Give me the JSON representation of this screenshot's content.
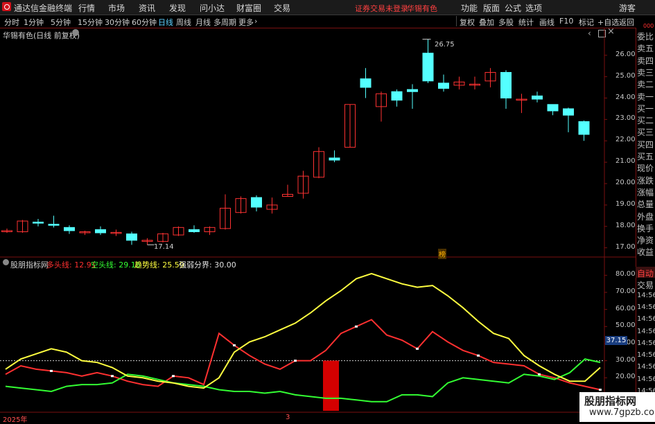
{
  "menu": {
    "app_title": "通达信金融终端",
    "items": [
      "行情",
      "市场",
      "资讯",
      "发现",
      "问小达",
      "财富圈",
      "交易"
    ],
    "login_status": "证券交易未登录",
    "stock_name": "华锡有色",
    "right_items": [
      "功能",
      "版面",
      "公式",
      "选项"
    ],
    "guest": "游客"
  },
  "periods": {
    "items": [
      "分时",
      "1分钟",
      "5分钟",
      "15分钟",
      "30分钟",
      "60分钟",
      "日线",
      "周线",
      "月线",
      "多周期",
      "更多"
    ],
    "active": "日线",
    "right_items": [
      "复权",
      "叠加",
      "多股",
      "统计",
      "画线",
      "F10",
      "标记",
      "+自选",
      "返回"
    ]
  },
  "main_chart": {
    "title": "华锡有色(日线 前复权)",
    "high_label": "26.75",
    "low_label": "17.14",
    "marker_label": "榜",
    "corner_label": "000"
  },
  "indicator": {
    "name": "股朋指标网",
    "lines": [
      {
        "label": "多头线:",
        "value": "12.91",
        "color": "#ff3030"
      },
      {
        "label": "空头线:",
        "value": "29.16",
        "color": "#33ff33"
      },
      {
        "label": "趋势线:",
        "value": "25.59",
        "color": "#ffff40"
      },
      {
        "label": "强弱分界:",
        "value": "30.00",
        "color": "#e0e0e0"
      }
    ],
    "current_value": "37.15"
  },
  "sidebar": {
    "main_items": [
      "委比",
      "卖五",
      "卖四",
      "卖三",
      "卖二",
      "卖一",
      "买一",
      "买二",
      "买三",
      "买四",
      "买五",
      "现价",
      "涨跌",
      "涨幅",
      "总量",
      "外盘",
      "换手",
      "净资",
      "收益"
    ],
    "sub_items": [
      "自动",
      "交易",
      "14:56",
      "14:56",
      "14:56",
      "14:56",
      "14:56",
      "14:56",
      "14:56",
      "14:56",
      "14:56"
    ]
  },
  "date_axis": {
    "labels": [
      "2025年",
      "3"
    ]
  },
  "watermark": {
    "line1": "股朋指标网",
    "line2": "www.7gpzb.com"
  },
  "chart_data": [
    {
      "type": "candlestick",
      "title": "华锡有色(日线 前复权)",
      "y_ticks": [
        17.0,
        18.0,
        19.0,
        20.0,
        21.0,
        22.0,
        23.0,
        24.0,
        25.0,
        26.0
      ],
      "ylim": [
        16.6,
        26.9
      ],
      "candles": [
        {
          "o": 17.78,
          "c": 17.8,
          "h": 17.9,
          "l": 17.7
        },
        {
          "o": 17.75,
          "c": 18.25,
          "h": 18.3,
          "l": 17.7
        },
        {
          "o": 18.2,
          "c": 18.15,
          "h": 18.35,
          "l": 18.0
        },
        {
          "o": 18.1,
          "c": 18.05,
          "h": 18.5,
          "l": 17.95
        },
        {
          "o": 17.95,
          "c": 17.8,
          "h": 18.05,
          "l": 17.65
        },
        {
          "o": 17.7,
          "c": 17.75,
          "h": 17.8,
          "l": 17.6
        },
        {
          "o": 17.85,
          "c": 17.7,
          "h": 18.0,
          "l": 17.6
        },
        {
          "o": 17.7,
          "c": 17.72,
          "h": 17.85,
          "l": 17.55
        },
        {
          "o": 17.65,
          "c": 17.35,
          "h": 17.75,
          "l": 17.14
        },
        {
          "o": 17.3,
          "c": 17.35,
          "h": 17.45,
          "l": 17.14
        },
        {
          "o": 17.3,
          "c": 17.65,
          "h": 17.7,
          "l": 17.25
        },
        {
          "o": 17.6,
          "c": 17.95,
          "h": 18.0,
          "l": 17.55
        },
        {
          "o": 17.85,
          "c": 17.75,
          "h": 18.05,
          "l": 17.7
        },
        {
          "o": 17.75,
          "c": 17.95,
          "h": 18.0,
          "l": 17.6
        },
        {
          "o": 17.9,
          "c": 18.85,
          "h": 19.5,
          "l": 17.85
        },
        {
          "o": 18.65,
          "c": 19.3,
          "h": 19.4,
          "l": 18.6
        },
        {
          "o": 19.35,
          "c": 18.9,
          "h": 19.45,
          "l": 18.7
        },
        {
          "o": 18.8,
          "c": 19.0,
          "h": 19.35,
          "l": 18.6
        },
        {
          "o": 19.4,
          "c": 19.5,
          "h": 19.95,
          "l": 19.4
        },
        {
          "o": 19.55,
          "c": 20.35,
          "h": 20.6,
          "l": 19.3
        },
        {
          "o": 20.3,
          "c": 21.5,
          "h": 21.7,
          "l": 20.25
        },
        {
          "o": 21.2,
          "c": 21.1,
          "h": 21.55,
          "l": 21.0
        },
        {
          "o": 21.7,
          "c": 23.7,
          "h": 23.7,
          "l": 21.7
        },
        {
          "o": 24.9,
          "c": 24.5,
          "h": 25.4,
          "l": 24.0
        },
        {
          "o": 23.6,
          "c": 24.2,
          "h": 24.3,
          "l": 22.9
        },
        {
          "o": 24.3,
          "c": 23.9,
          "h": 24.4,
          "l": 23.6
        },
        {
          "o": 24.4,
          "c": 24.3,
          "h": 24.65,
          "l": 23.5
        },
        {
          "o": 26.1,
          "c": 24.8,
          "h": 26.75,
          "l": 24.7
        },
        {
          "o": 24.7,
          "c": 24.45,
          "h": 25.1,
          "l": 24.3
        },
        {
          "o": 24.6,
          "c": 24.75,
          "h": 25.0,
          "l": 24.4
        },
        {
          "o": 24.6,
          "c": 24.65,
          "h": 25.0,
          "l": 24.4
        },
        {
          "o": 24.8,
          "c": 25.2,
          "h": 25.4,
          "l": 24.5
        },
        {
          "o": 25.2,
          "c": 24.0,
          "h": 25.3,
          "l": 23.5
        },
        {
          "o": 23.95,
          "c": 23.95,
          "h": 24.2,
          "l": 23.3
        },
        {
          "o": 24.1,
          "c": 23.95,
          "h": 24.3,
          "l": 23.8
        },
        {
          "o": 23.7,
          "c": 23.4,
          "h": 23.7,
          "l": 23.2
        },
        {
          "o": 23.5,
          "c": 23.2,
          "h": 23.55,
          "l": 22.4
        },
        {
          "o": 22.9,
          "c": 22.3,
          "h": 22.95,
          "l": 22.0
        }
      ]
    },
    {
      "type": "line",
      "title": "股朋指标网",
      "y_ticks": [
        20,
        30,
        40,
        50,
        60,
        70,
        80
      ],
      "ylim": [
        12,
        85
      ],
      "threshold": 30,
      "series": [
        {
          "name": "多头线",
          "color": "#ff3030",
          "values": [
            22,
            27,
            25,
            24,
            23,
            21,
            23,
            21,
            18,
            16,
            15,
            21,
            20,
            16,
            46,
            39,
            33,
            28,
            25,
            30,
            30,
            36,
            46,
            50,
            54,
            45,
            42,
            37,
            47,
            41,
            36,
            33,
            29,
            28,
            27,
            22,
            20,
            17,
            15,
            13
          ]
        },
        {
          "name": "空头线",
          "color": "#33ff33",
          "values": [
            15,
            14,
            13,
            12,
            15,
            16,
            16,
            17,
            22,
            21,
            19,
            17,
            16,
            15,
            13,
            12,
            12,
            11,
            12,
            10,
            9,
            8,
            8,
            7,
            6,
            6,
            10,
            10,
            9,
            17,
            20,
            19,
            18,
            17,
            22,
            21,
            19,
            23,
            31,
            29
          ]
        },
        {
          "name": "趋势线",
          "color": "#ffff40",
          "values": [
            25,
            31,
            34,
            37,
            35,
            30,
            29,
            26,
            21,
            20,
            18,
            17,
            15,
            14,
            20,
            35,
            41,
            44,
            48,
            52,
            58,
            65,
            71,
            78,
            81,
            78,
            75,
            73,
            74,
            68,
            61,
            53,
            46,
            43,
            33,
            27,
            22,
            18,
            18,
            26
          ]
        }
      ],
      "signal_bar": {
        "index": 20,
        "from": 0,
        "to": 30
      }
    }
  ]
}
